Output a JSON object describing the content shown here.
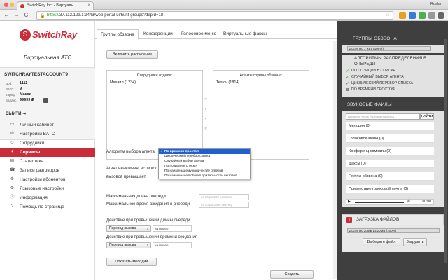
{
  "browser": {
    "tab_title": "SwitchRay Inc. - Виртуаль...",
    "tab_close": "×",
    "user": "Ruslan",
    "back": "←",
    "forward": "→",
    "reload": "C",
    "url_scheme": "https://",
    "url_rest": "37.112.129.1:9443/web-portal-ui/hunt-groups?depId=18",
    "lock": "🔒",
    "star": "☆"
  },
  "logo": {
    "glyph": "S",
    "brand": "SwitchRay",
    "subtitle": "Виртуальная АТС"
  },
  "account": {
    "title": "SWITCHRAYTESTACCOUNT9",
    "rows": [
      {
        "label": "Доб.",
        "value": "1111"
      },
      {
        "label": "ВАТС",
        "value": "9"
      },
      {
        "label": "Тариф",
        "value": "Макси"
      },
      {
        "label": "Баланс",
        "value": "99999 ₽"
      }
    ],
    "logout": "ВЫЙТИ ⇥"
  },
  "menu": [
    {
      "label": "Личный кабинет",
      "icon": "▭",
      "name": "sidebar-item-cabinet"
    },
    {
      "label": "Настройки ВАТС",
      "icon": "⚙",
      "name": "sidebar-item-vats-settings"
    },
    {
      "label": "Сотрудники",
      "icon": "☺",
      "name": "sidebar-item-employees"
    },
    {
      "label": "Сервисы",
      "icon": "✦",
      "name": "sidebar-item-services",
      "active": true
    },
    {
      "label": "Статистика",
      "icon": "▤",
      "name": "sidebar-item-statistics"
    },
    {
      "label": "Записи разговоров",
      "icon": "☎",
      "name": "sidebar-item-recordings"
    },
    {
      "label": "Настройки абонентов",
      "icon": "⚙",
      "name": "sidebar-item-subscriber-settings"
    },
    {
      "label": "Языковые настройки",
      "icon": "⚙",
      "name": "sidebar-item-language"
    },
    {
      "label": "Информация",
      "icon": "ⓘ",
      "name": "sidebar-item-info"
    },
    {
      "label": "Помощь по странице",
      "icon": "?",
      "name": "sidebar-item-help"
    }
  ],
  "tabs": [
    {
      "label": "Группы обзвона",
      "active": true
    },
    {
      "label": "Конференции"
    },
    {
      "label": "Голосовое меню"
    },
    {
      "label": "Виртуальные факсы"
    }
  ],
  "form": {
    "schedule_button": "Включить расписание",
    "employees_label": "Сотрудники отдела:",
    "employees_entry": "Михаил (1234)",
    "agents_label": "Агенты группы обзвона:",
    "agents_entry": "Testov (1814)",
    "arrows": [
      "»",
      "›",
      "‹",
      "«"
    ],
    "algo_label": "Алгоритм выбора агента",
    "inactive_label_1": "Агент неактивен, если кол",
    "inactive_label_2": "вызовов превышает",
    "max_queue_label": "Максимальная длина очереди",
    "max_queue_placeholder": "от 10 до 200 человек",
    "max_wait_label": "Максимальное время ожидания в очереди",
    "max_wait_placeholder": "от 30 до 3000 секунд",
    "queue_exceed_label": "Действие при превышении длины очереди",
    "queue_exceed_action": "Перевод вызова",
    "queue_exceed_to": "на номер",
    "wait_exceed_label": "Действие при превышении времени ожидания",
    "wait_exceed_action": "Перевод вызова",
    "wait_exceed_to": "на номер",
    "show_melodies": "Показать мелодии",
    "create_button": "Создать",
    "caret": "⬍",
    "dropdown": [
      {
        "label": "По времени простоя",
        "selected": true
      },
      {
        "label": "Циклический перебор списка"
      },
      {
        "label": "Случайный выбор агента"
      },
      {
        "label": "По позиции в списке"
      },
      {
        "label": "По наименьшему количеству ответов"
      },
      {
        "label": "По наименьшей общей длительности вызовов"
      }
    ]
  },
  "right": {
    "groups_title": "ГРУППЫ ОБЗВОНА",
    "groups_progress_text": "Доступно 1 из 1 (100%)",
    "groups_progress": 1.0,
    "algo_title": "АЛГОРИТМЫ РАСПРЕДЕЛЕНИЯ В ОЧЕРЕДИ",
    "algos": [
      {
        "label": "ПО ПОЗИЦИИ В СПИСКЕ",
        "checked": true
      },
      {
        "label": "СЛУЧАЙНЫЙ ВЫБОР АГЕНТА",
        "checked": true
      },
      {
        "label": "ЦИКЛИЧЕСКИЙ ПЕРЕБОР СПИСКА",
        "checked": true
      },
      {
        "label": "ПО ВРЕМЕНИ ПРОСТОЯ",
        "checked": false
      }
    ],
    "check": "✓",
    "sounds_title": "ЗВУКОВЫЕ ФАЙЛЫ",
    "search_placeholder": "Введите часть названия файла",
    "find_button": "НАЙТИ",
    "sounds": [
      "Мелодии (0)",
      "Голосовое меню (0)",
      "Конференц-комнаты (0)",
      "Факсы (0)",
      "Группы обзвона (0)",
      "Приветствие голосовой почты (0)"
    ],
    "player_play": "▶",
    "player_time": "00:00",
    "player_volume": "🔊",
    "upload_title": "ЗАГРУЗКА ФАЙЛОВ",
    "upload_icon": "⇧",
    "upload_progress_text": "Доступно 20МБ из 20МБ (100%)",
    "upload_progress": 1.0,
    "choose_file": "Выберите файл",
    "upload_button": "Загрузить"
  }
}
